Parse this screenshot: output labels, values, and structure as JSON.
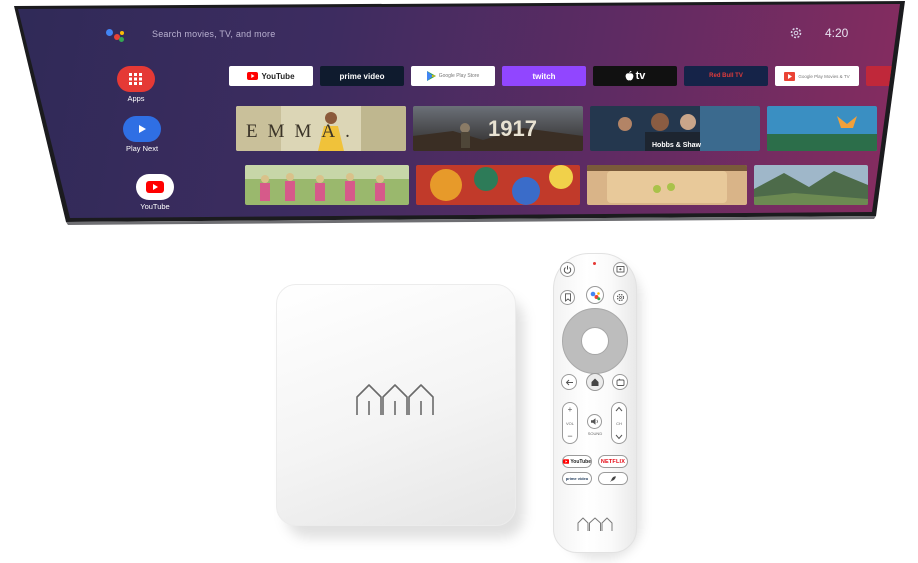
{
  "tv": {
    "search_placeholder": "Search movies, TV, and more",
    "clock": "4:20",
    "sidebar": [
      {
        "label": "Apps",
        "icon": "apps-grid-icon",
        "color": "#e53935"
      },
      {
        "label": "Play Next",
        "icon": "play-icon",
        "color": "#2f6fe4"
      },
      {
        "label": "YouTube",
        "icon": "youtube-icon",
        "color": "#ffffff"
      }
    ],
    "apps_row": [
      {
        "name": "YouTube",
        "icon": "youtube-icon",
        "bg": "#ffffff",
        "fg": "#222222"
      },
      {
        "name": "prime video",
        "icon": "prime-video-icon",
        "bg": "#0f1b2e",
        "fg": "#ffffff"
      },
      {
        "name": "Google Play Store",
        "icon": "play-store-icon",
        "bg": "#ffffff",
        "fg": "#777777"
      },
      {
        "name": "twitch",
        "icon": "twitch-icon",
        "bg": "#9146ff",
        "fg": "#ffffff"
      },
      {
        "name": "tv",
        "icon": "apple-icon",
        "bg": "#111111",
        "fg": "#ffffff"
      },
      {
        "name": "Red Bull TV",
        "icon": "red-bull-icon",
        "bg": "#152348",
        "fg": "#e13b3b"
      },
      {
        "name": "Google Play Movies & TV",
        "icon": "play-movies-icon",
        "bg": "#ffffff",
        "fg": "#777777"
      }
    ],
    "row1_thumbs": [
      {
        "title": "EMMA.",
        "name": "emma-thumbnail"
      },
      {
        "title": "1917",
        "name": "1917-thumbnail"
      },
      {
        "title": "Hobbs & Shaw",
        "name": "hobbs-shaw-thumbnail"
      },
      {
        "title": "",
        "name": "nature-thumbnail"
      }
    ],
    "row2_thumbs": [
      {
        "name": "dancers-thumbnail"
      },
      {
        "name": "paint-thumbnail"
      },
      {
        "name": "cooking-thumbnail"
      },
      {
        "name": "mountain-thumbnail"
      }
    ]
  },
  "remote": {
    "volume_label": "VOL",
    "channel_label": "CH",
    "mute_label": "SOUND",
    "youtube_label": "YouTube",
    "netflix_label": "NETFLIX",
    "prime_label": "prime video"
  },
  "colors": {
    "screen_left": "#2f2a57",
    "screen_right": "#8a2c5f",
    "netflix_red": "#e50914",
    "youtube_red": "#ff0000"
  }
}
